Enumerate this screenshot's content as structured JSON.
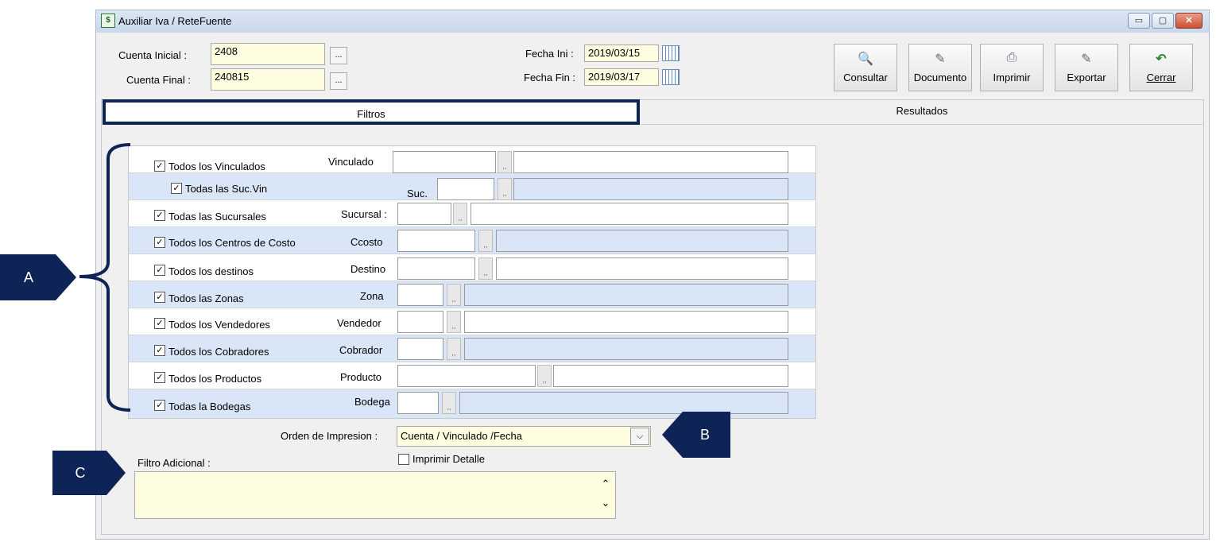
{
  "window": {
    "title": "Auxiliar Iva / ReteFuente",
    "app_icon_glyph": "$",
    "controls": {
      "minimize": "▭",
      "maximize": "▢",
      "close": "✕"
    }
  },
  "header": {
    "cuenta_inicial_label": "Cuenta Inicial :",
    "cuenta_inicial_value": "2408",
    "cuenta_final_label": "Cuenta Final :",
    "cuenta_final_value": "240815",
    "dots": "...",
    "fecha_ini_label": "Fecha Ini :",
    "fecha_ini_value": "2019/03/15",
    "fecha_fin_label": "Fecha Fin :",
    "fecha_fin_value": "2019/03/17"
  },
  "toolbar": [
    {
      "label": "Consultar",
      "icon": "🔍"
    },
    {
      "label": "Documento",
      "icon": "✎"
    },
    {
      "label": "Imprimir",
      "icon": "⎙"
    },
    {
      "label": "Exportar",
      "icon": "✎"
    },
    {
      "label": "Cerrar",
      "icon": "↶",
      "color": "#2a8a2a"
    }
  ],
  "tabs": {
    "filtros": "Filtros",
    "resultados": "Resultados"
  },
  "filters": [
    {
      "check": "Todos los Vinculados",
      "field": "Vinculado"
    },
    {
      "check": "Todas las Suc.Vin",
      "field": "Suc."
    },
    {
      "check": "Todas las Sucursales",
      "field": "Sucursal :"
    },
    {
      "check": "Todos los Centros de Costo",
      "field": "Ccosto"
    },
    {
      "check": "Todos los destinos",
      "field": "Destino"
    },
    {
      "check": "Todos las Zonas",
      "field": "Zona"
    },
    {
      "check": "Todos los Vendedores",
      "field": "Vendedor"
    },
    {
      "check": "Todos los Cobradores",
      "field": "Cobrador"
    },
    {
      "check": "Todos los Productos",
      "field": "Producto"
    },
    {
      "check": "Todas la Bodegas",
      "field": "Bodega"
    }
  ],
  "checkmark": "✓",
  "field_dots": ",,",
  "orden": {
    "label": "Orden de Impresion :",
    "value": "Cuenta / Vinculado /Fecha",
    "arrow": "⌵"
  },
  "imprimir_detalle": "Imprimir Detalle",
  "filtro_adicional": {
    "label": "Filtro Adicional :",
    "value": "",
    "scroll_up": "⌃",
    "scroll_down": "⌄"
  },
  "callouts": {
    "a": "A",
    "b": "B",
    "c": "C"
  },
  "colors": {
    "callout": "#0e2356",
    "input_bg": "#fffde0",
    "alt_row": "#d8e6f7"
  }
}
